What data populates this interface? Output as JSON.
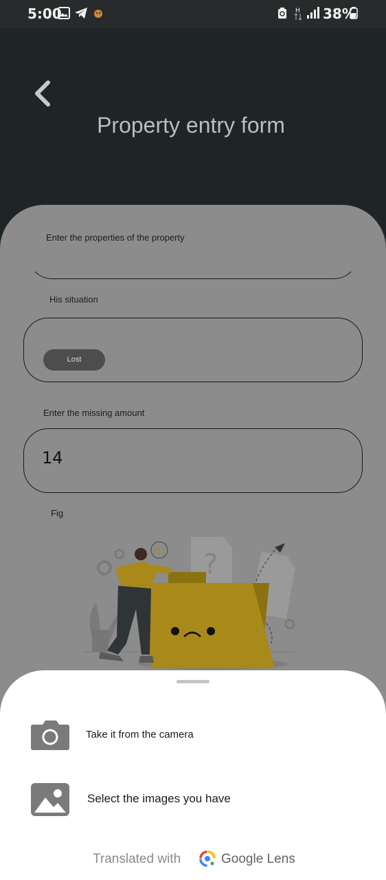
{
  "status_bar": {
    "time": "5:00",
    "battery_percent": "38%",
    "icons": [
      "gallery-icon",
      "telegram-icon",
      "app-notification-icon",
      "recycle-icon",
      "data-arrows-icon",
      "signal-icon",
      "battery-icon"
    ]
  },
  "header": {
    "back_icon": "chevron-left-icon",
    "title": "Property entry form"
  },
  "form": {
    "section_label": "Enter the properties of the property",
    "situation_label": "His situation",
    "situation_chip": "Lost",
    "missing_amount_label": "Enter the missing amount",
    "missing_amount_value": "14",
    "fig_label": "Fig",
    "illustration": "person-pushing-folder-illustration"
  },
  "sheet": {
    "option_camera": "Take it from the camera",
    "option_gallery": "Select the images you have",
    "footer_prefix": "Translated with",
    "footer_brand": "Google Lens"
  },
  "colors": {
    "header_bg": "#1f2527",
    "card_bg": "#8c8c8c",
    "folder": "#a8891a",
    "sheet_bg": "#ffffff"
  }
}
